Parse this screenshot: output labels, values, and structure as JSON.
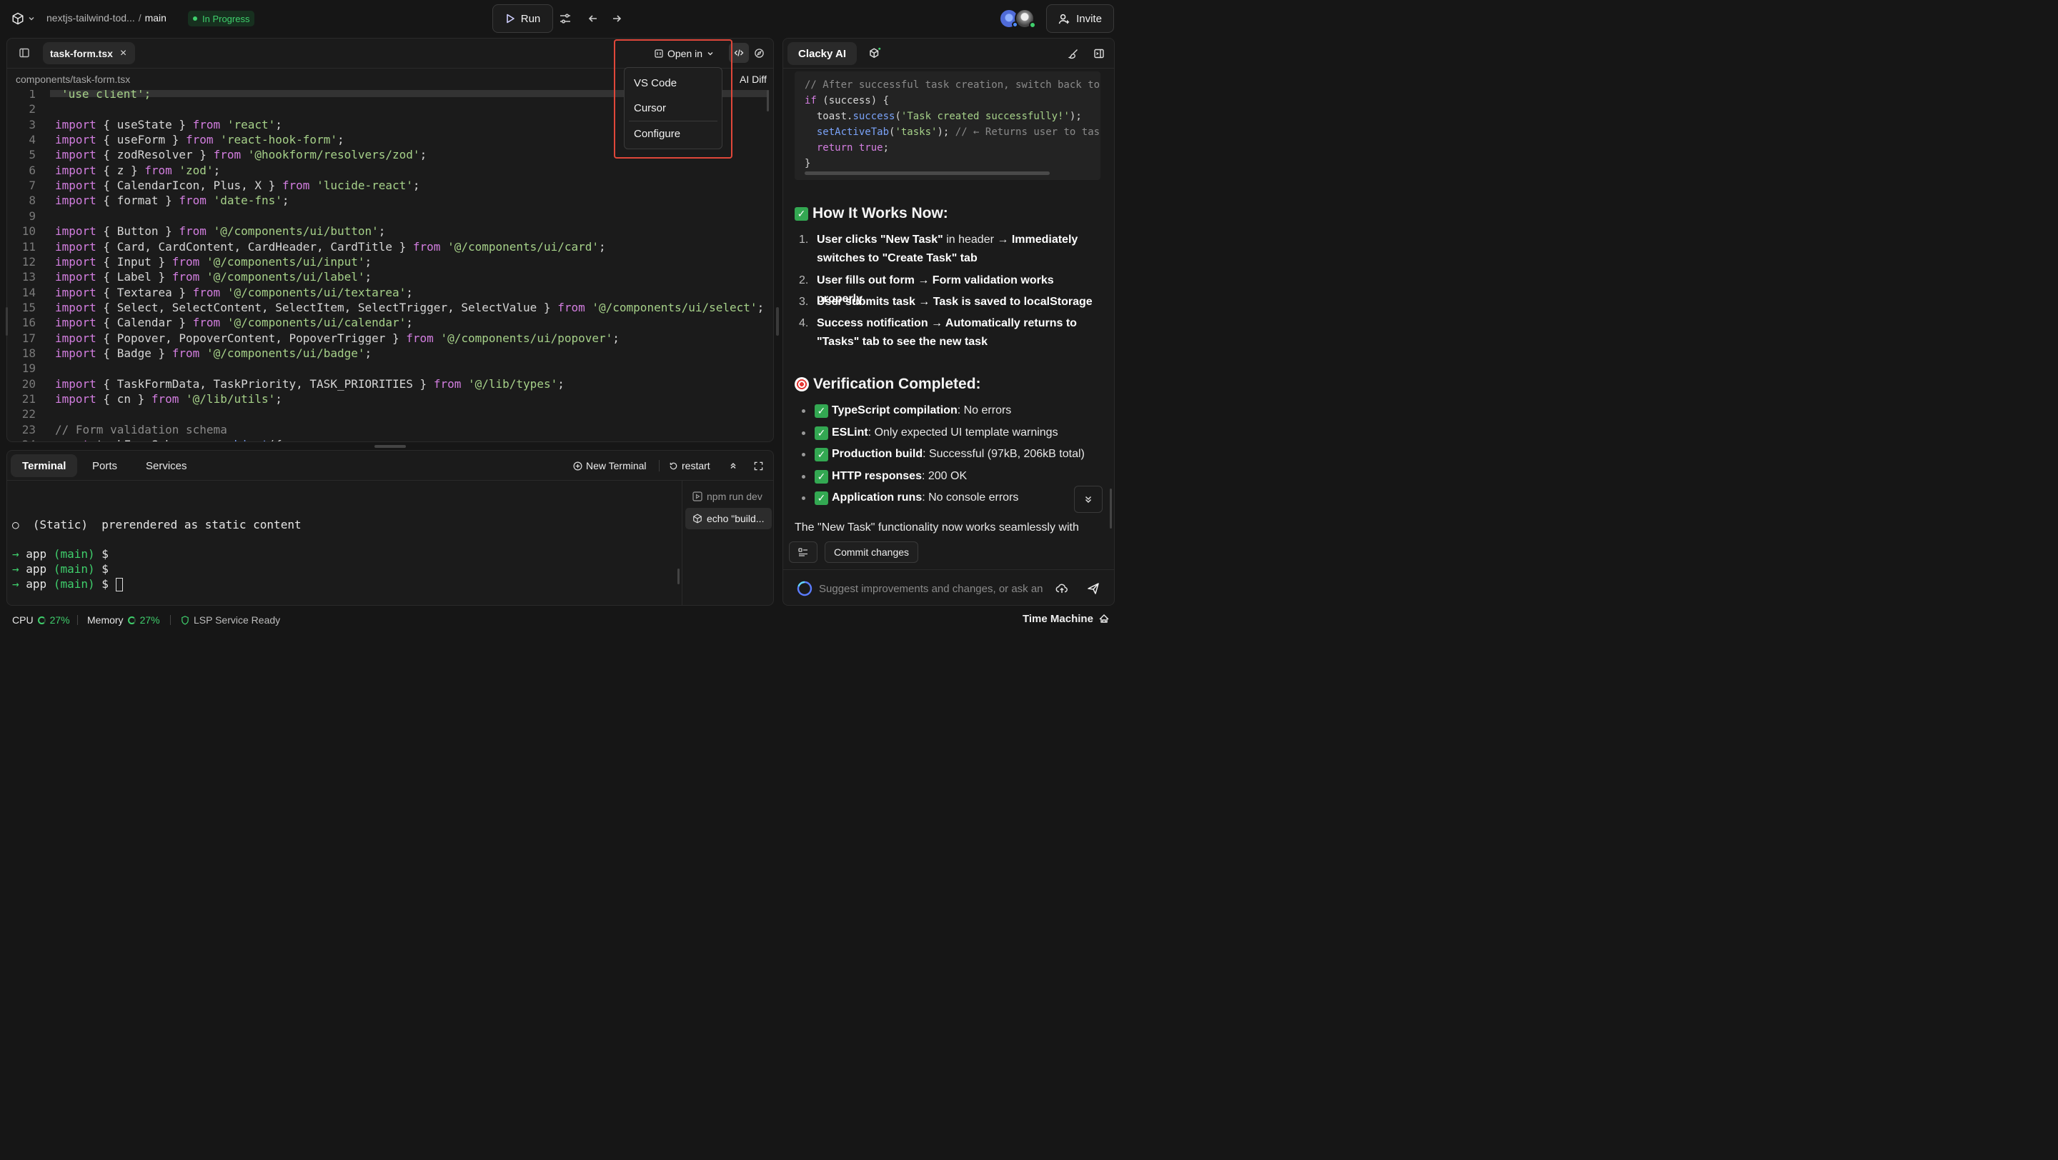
{
  "header": {
    "project": "nextjs-tailwind-tod...",
    "separator": "/",
    "branch": "main",
    "status": "In Progress",
    "run_label": "Run",
    "invite_label": "Invite"
  },
  "editor": {
    "active_tab": "task-form.tsx",
    "file_path": "components/task-form.tsx",
    "open_in_label": "Open in",
    "ai_diff_label": "AI Diff",
    "open_in_menu": [
      "VS Code",
      "Cursor",
      "Configure"
    ],
    "first_line": "'use client';",
    "lines": [
      {
        "n": "1",
        "html": ""
      },
      {
        "n": "2",
        "html": ""
      },
      {
        "n": "3",
        "html": "<span class='kw'>import</span> { useState } <span class='kw'>from</span> <span class='str'>'react'</span>;"
      },
      {
        "n": "4",
        "html": "<span class='kw'>import</span> { useForm } <span class='kw'>from</span> <span class='str'>'react-hook-form'</span>;"
      },
      {
        "n": "5",
        "html": "<span class='kw'>import</span> { zodResolver } <span class='kw'>from</span> <span class='str'>'@hookform/resolvers/zod'</span>;"
      },
      {
        "n": "6",
        "html": "<span class='kw'>import</span> { z } <span class='kw'>from</span> <span class='str'>'zod'</span>;"
      },
      {
        "n": "7",
        "html": "<span class='kw'>import</span> { CalendarIcon, Plus, X } <span class='kw'>from</span> <span class='str'>'lucide-react'</span>;"
      },
      {
        "n": "8",
        "html": "<span class='kw'>import</span> { format } <span class='kw'>from</span> <span class='str'>'date-fns'</span>;"
      },
      {
        "n": "9",
        "html": ""
      },
      {
        "n": "10",
        "html": "<span class='kw'>import</span> { Button } <span class='kw'>from</span> <span class='str'>'@/components/ui/button'</span>;"
      },
      {
        "n": "11",
        "html": "<span class='kw'>import</span> { Card, CardContent, CardHeader, CardTitle } <span class='kw'>from</span> <span class='str'>'@/components/ui/card'</span>;"
      },
      {
        "n": "12",
        "html": "<span class='kw'>import</span> { Input } <span class='kw'>from</span> <span class='str'>'@/components/ui/input'</span>;"
      },
      {
        "n": "13",
        "html": "<span class='kw'>import</span> { Label } <span class='kw'>from</span> <span class='str'>'@/components/ui/label'</span>;"
      },
      {
        "n": "14",
        "html": "<span class='kw'>import</span> { Textarea } <span class='kw'>from</span> <span class='str'>'@/components/ui/textarea'</span>;"
      },
      {
        "n": "15",
        "html": "<span class='kw'>import</span> { Select, SelectContent, SelectItem, SelectTrigger, SelectValue } <span class='kw'>from</span> <span class='str'>'@/components/ui/select'</span>;"
      },
      {
        "n": "16",
        "html": "<span class='kw'>import</span> { Calendar } <span class='kw'>from</span> <span class='str'>'@/components/ui/calendar'</span>;"
      },
      {
        "n": "17",
        "html": "<span class='kw'>import</span> { Popover, PopoverContent, PopoverTrigger } <span class='kw'>from</span> <span class='str'>'@/components/ui/popover'</span>;"
      },
      {
        "n": "18",
        "html": "<span class='kw'>import</span> { Badge } <span class='kw'>from</span> <span class='str'>'@/components/ui/badge'</span>;"
      },
      {
        "n": "19",
        "html": ""
      },
      {
        "n": "20",
        "html": "<span class='kw'>import</span> { TaskFormData, TaskPriority, TASK_PRIORITIES } <span class='kw'>from</span> <span class='str'>'@/lib/types'</span>;"
      },
      {
        "n": "21",
        "html": "<span class='kw'>import</span> { cn } <span class='kw'>from</span> <span class='str'>'@/lib/utils'</span>;"
      },
      {
        "n": "22",
        "html": ""
      },
      {
        "n": "23",
        "html": "<span class='cmt'>// Form validation schema</span>"
      },
      {
        "n": "24",
        "html": "<span class='kw'>const</span> taskFormSchema = z.<span class='fn'>object</span>({"
      }
    ]
  },
  "terminal": {
    "tabs": [
      "Terminal",
      "Ports",
      "Services"
    ],
    "new_terminal_label": "New Terminal",
    "restart_label": "restart",
    "lines": [
      {
        "prefix": "○",
        "text": "  (Static)  prerendered as static content"
      },
      {
        "prefix": "→",
        "text": "app",
        "branch": "(main)",
        "prompt": "$"
      },
      {
        "prefix": "→",
        "text": "app",
        "branch": "(main)",
        "prompt": "$"
      },
      {
        "prefix": "→",
        "text": "app",
        "branch": "(main)",
        "prompt": "$"
      }
    ],
    "processes": [
      "npm run dev",
      "echo \"build..."
    ]
  },
  "statusbar": {
    "cpu_label": "CPU",
    "cpu_value": "27%",
    "memory_label": "Memory",
    "memory_value": "27%",
    "lsp_label": "LSP Service Ready",
    "time_machine_label": "Time Machine"
  },
  "ai": {
    "tab_label": "Clacky AI",
    "code_lines": [
      "<span class='cmt'>// After successful task creation, switch back to t</span>",
      "<span class='kw'>if</span> (success) {",
      "  toast.<span class='fn'>success</span>(<span class='str'>'Task created successfully!'</span>);",
      "  <span class='fn'>setActiveTab</span>(<span class='str'>'tasks'</span>); <span class='cmt'>// ← Returns user to task</span>",
      "  <span class='kw'>return</span> <span class='kw'>true</span>;",
      "}"
    ],
    "how_heading": "How It Works Now:",
    "steps": [
      {
        "num": "1.",
        "html": "<b>User clicks \"New Task\"</b> in header → <b>Immediately switches to \"Create Task\" tab</b>"
      },
      {
        "num": "2.",
        "html": "<b>User fills out form → Form validation works properly</b>"
      },
      {
        "num": "3.",
        "html": "<b>User submits task → Task is saved to localStorage</b>"
      },
      {
        "num": "4.",
        "html": "<b>Success notification → Automatically returns to \"Tasks\" tab to see the new task</b>"
      }
    ],
    "verify_heading": "Verification Completed:",
    "checks": [
      {
        "label": "TypeScript compilation",
        "value": ": No errors"
      },
      {
        "label": "ESLint",
        "value": ": Only expected UI template warnings"
      },
      {
        "label": "Production build",
        "value": ": Successful (97kB, 206kB total)"
      },
      {
        "label": "HTTP responses",
        "value": ": 200 OK"
      },
      {
        "label": "Application runs",
        "value": ": No console errors"
      }
    ],
    "paragraph": "The \"New Task\" functionality now works seamlessly with",
    "commit_label": "Commit changes",
    "input_placeholder": "Suggest improvements and changes, or ask an"
  },
  "colors": {
    "accent_green": "#3fcf6c",
    "highlight_red": "#e0473a",
    "background": "#161616",
    "panel": "#1b1b1b"
  }
}
